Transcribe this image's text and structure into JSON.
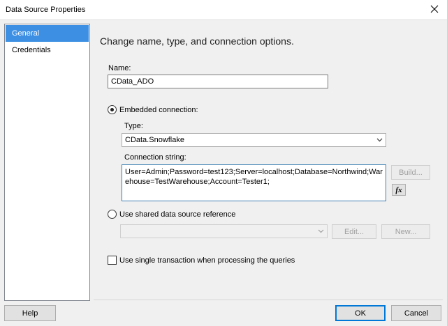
{
  "window": {
    "title": "Data Source Properties"
  },
  "nav": {
    "items": [
      {
        "label": "General",
        "selected": true
      },
      {
        "label": "Credentials",
        "selected": false
      }
    ]
  },
  "general": {
    "heading": "Change name, type, and connection options.",
    "name_label": "Name:",
    "name_value": "CData_ADO",
    "embedded_label": "Embedded connection:",
    "embedded_selected": true,
    "type_label": "Type:",
    "type_value": "CData.Snowflake",
    "connstr_label": "Connection string:",
    "connstr_value": "User=Admin;Password=test123;Server=localhost;Database=Northwind;Warehouse=TestWarehouse;Account=Tester1;",
    "build_label": "Build...",
    "fx_label": "fx",
    "shared_label": "Use shared data source reference",
    "shared_selected": false,
    "shared_value": "",
    "edit_label": "Edit...",
    "new_label": "New...",
    "single_txn_label": "Use single transaction when processing the queries",
    "single_txn_checked": false
  },
  "footer": {
    "help_label": "Help",
    "ok_label": "OK",
    "cancel_label": "Cancel"
  }
}
